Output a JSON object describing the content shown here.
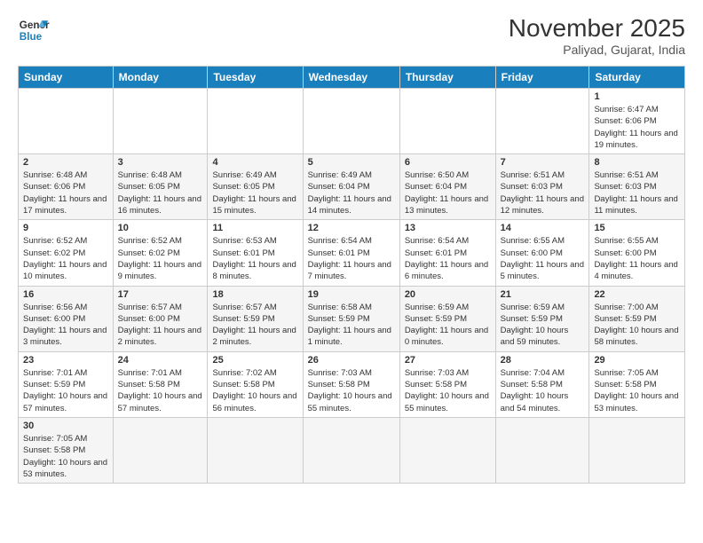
{
  "logo": {
    "text_general": "General",
    "text_blue": "Blue"
  },
  "header": {
    "month_year": "November 2025",
    "location": "Paliyad, Gujarat, India"
  },
  "days_of_week": [
    "Sunday",
    "Monday",
    "Tuesday",
    "Wednesday",
    "Thursday",
    "Friday",
    "Saturday"
  ],
  "weeks": [
    [
      {
        "day": "",
        "info": ""
      },
      {
        "day": "",
        "info": ""
      },
      {
        "day": "",
        "info": ""
      },
      {
        "day": "",
        "info": ""
      },
      {
        "day": "",
        "info": ""
      },
      {
        "day": "",
        "info": ""
      },
      {
        "day": "1",
        "info": "Sunrise: 6:47 AM\nSunset: 6:06 PM\nDaylight: 11 hours and 19 minutes."
      }
    ],
    [
      {
        "day": "2",
        "info": "Sunrise: 6:48 AM\nSunset: 6:06 PM\nDaylight: 11 hours and 17 minutes."
      },
      {
        "day": "3",
        "info": "Sunrise: 6:48 AM\nSunset: 6:05 PM\nDaylight: 11 hours and 16 minutes."
      },
      {
        "day": "4",
        "info": "Sunrise: 6:49 AM\nSunset: 6:05 PM\nDaylight: 11 hours and 15 minutes."
      },
      {
        "day": "5",
        "info": "Sunrise: 6:49 AM\nSunset: 6:04 PM\nDaylight: 11 hours and 14 minutes."
      },
      {
        "day": "6",
        "info": "Sunrise: 6:50 AM\nSunset: 6:04 PM\nDaylight: 11 hours and 13 minutes."
      },
      {
        "day": "7",
        "info": "Sunrise: 6:51 AM\nSunset: 6:03 PM\nDaylight: 11 hours and 12 minutes."
      },
      {
        "day": "8",
        "info": "Sunrise: 6:51 AM\nSunset: 6:03 PM\nDaylight: 11 hours and 11 minutes."
      }
    ],
    [
      {
        "day": "9",
        "info": "Sunrise: 6:52 AM\nSunset: 6:02 PM\nDaylight: 11 hours and 10 minutes."
      },
      {
        "day": "10",
        "info": "Sunrise: 6:52 AM\nSunset: 6:02 PM\nDaylight: 11 hours and 9 minutes."
      },
      {
        "day": "11",
        "info": "Sunrise: 6:53 AM\nSunset: 6:01 PM\nDaylight: 11 hours and 8 minutes."
      },
      {
        "day": "12",
        "info": "Sunrise: 6:54 AM\nSunset: 6:01 PM\nDaylight: 11 hours and 7 minutes."
      },
      {
        "day": "13",
        "info": "Sunrise: 6:54 AM\nSunset: 6:01 PM\nDaylight: 11 hours and 6 minutes."
      },
      {
        "day": "14",
        "info": "Sunrise: 6:55 AM\nSunset: 6:00 PM\nDaylight: 11 hours and 5 minutes."
      },
      {
        "day": "15",
        "info": "Sunrise: 6:55 AM\nSunset: 6:00 PM\nDaylight: 11 hours and 4 minutes."
      }
    ],
    [
      {
        "day": "16",
        "info": "Sunrise: 6:56 AM\nSunset: 6:00 PM\nDaylight: 11 hours and 3 minutes."
      },
      {
        "day": "17",
        "info": "Sunrise: 6:57 AM\nSunset: 6:00 PM\nDaylight: 11 hours and 2 minutes."
      },
      {
        "day": "18",
        "info": "Sunrise: 6:57 AM\nSunset: 5:59 PM\nDaylight: 11 hours and 2 minutes."
      },
      {
        "day": "19",
        "info": "Sunrise: 6:58 AM\nSunset: 5:59 PM\nDaylight: 11 hours and 1 minute."
      },
      {
        "day": "20",
        "info": "Sunrise: 6:59 AM\nSunset: 5:59 PM\nDaylight: 11 hours and 0 minutes."
      },
      {
        "day": "21",
        "info": "Sunrise: 6:59 AM\nSunset: 5:59 PM\nDaylight: 10 hours and 59 minutes."
      },
      {
        "day": "22",
        "info": "Sunrise: 7:00 AM\nSunset: 5:59 PM\nDaylight: 10 hours and 58 minutes."
      }
    ],
    [
      {
        "day": "23",
        "info": "Sunrise: 7:01 AM\nSunset: 5:59 PM\nDaylight: 10 hours and 57 minutes."
      },
      {
        "day": "24",
        "info": "Sunrise: 7:01 AM\nSunset: 5:58 PM\nDaylight: 10 hours and 57 minutes."
      },
      {
        "day": "25",
        "info": "Sunrise: 7:02 AM\nSunset: 5:58 PM\nDaylight: 10 hours and 56 minutes."
      },
      {
        "day": "26",
        "info": "Sunrise: 7:03 AM\nSunset: 5:58 PM\nDaylight: 10 hours and 55 minutes."
      },
      {
        "day": "27",
        "info": "Sunrise: 7:03 AM\nSunset: 5:58 PM\nDaylight: 10 hours and 55 minutes."
      },
      {
        "day": "28",
        "info": "Sunrise: 7:04 AM\nSunset: 5:58 PM\nDaylight: 10 hours and 54 minutes."
      },
      {
        "day": "29",
        "info": "Sunrise: 7:05 AM\nSunset: 5:58 PM\nDaylight: 10 hours and 53 minutes."
      }
    ],
    [
      {
        "day": "30",
        "info": "Sunrise: 7:05 AM\nSunset: 5:58 PM\nDaylight: 10 hours and 53 minutes."
      },
      {
        "day": "",
        "info": ""
      },
      {
        "day": "",
        "info": ""
      },
      {
        "day": "",
        "info": ""
      },
      {
        "day": "",
        "info": ""
      },
      {
        "day": "",
        "info": ""
      },
      {
        "day": "",
        "info": ""
      }
    ]
  ]
}
